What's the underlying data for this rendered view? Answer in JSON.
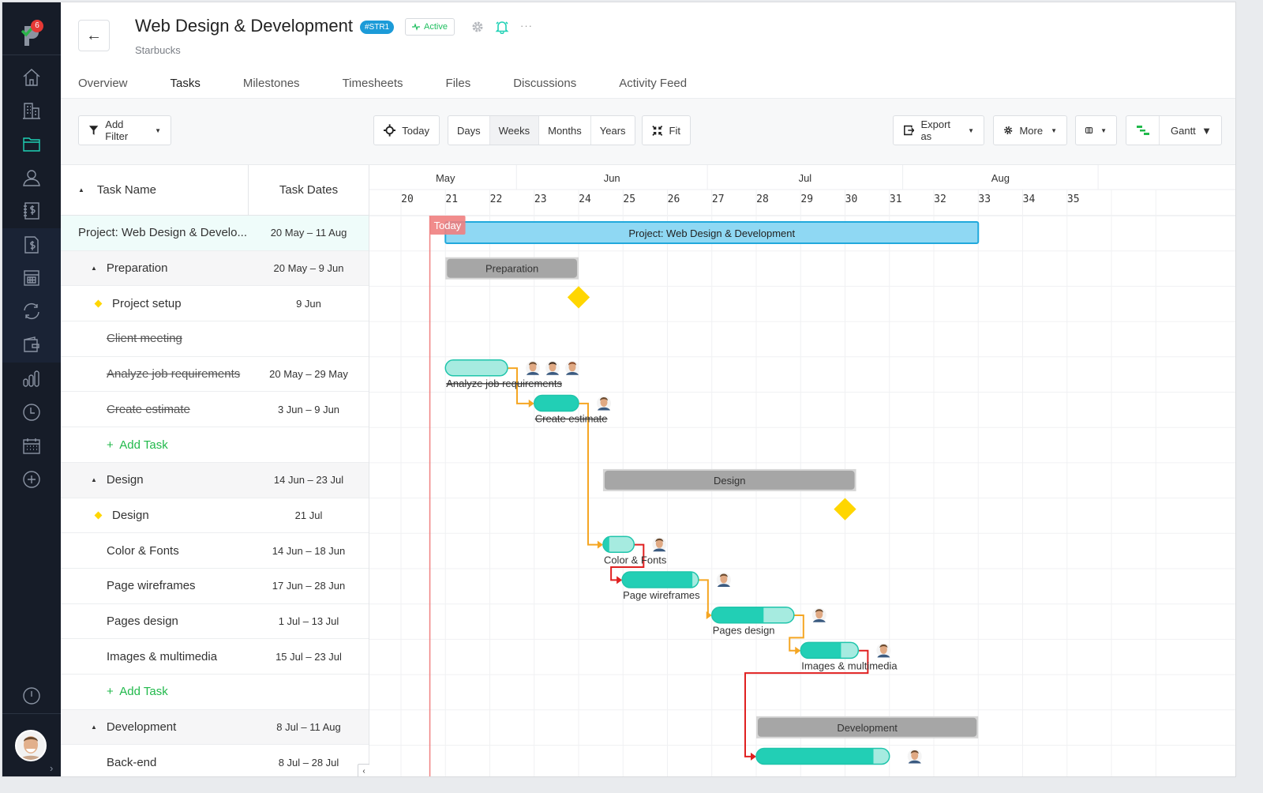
{
  "sidebar": {
    "logo_badge": "6",
    "items": [
      {
        "icon": "home-icon",
        "active": false
      },
      {
        "icon": "buildings-icon",
        "active": false
      },
      {
        "icon": "folder-icon",
        "active": true
      },
      {
        "icon": "user-icon",
        "active": false
      },
      {
        "icon": "ledger-dollar-icon",
        "active": false
      },
      {
        "icon": "invoice-dollar-icon",
        "active": false
      },
      {
        "icon": "calculator-icon",
        "active": false
      },
      {
        "icon": "sync-icon",
        "active": false
      },
      {
        "icon": "wallet-icon",
        "active": false
      },
      {
        "icon": "bar-chart-icon",
        "active": false
      },
      {
        "icon": "clock-icon",
        "active": false
      },
      {
        "icon": "calendar-icon",
        "active": false
      },
      {
        "icon": "plus-circle-icon",
        "active": false
      }
    ],
    "bottom_icon": "info-icon"
  },
  "header": {
    "title": "Web Design & Development",
    "tag": "#STR1",
    "status": "Active",
    "client": "Starbucks",
    "accent_color": "#1fd1b5"
  },
  "tabs": [
    {
      "label": "Overview",
      "active": false
    },
    {
      "label": "Tasks",
      "active": true
    },
    {
      "label": "Milestones",
      "active": false
    },
    {
      "label": "Timesheets",
      "active": false
    },
    {
      "label": "Files",
      "active": false
    },
    {
      "label": "Discussions",
      "active": false
    },
    {
      "label": "Activity Feed",
      "active": false
    }
  ],
  "toolbar": {
    "add_filter": "Add Filter",
    "today": "Today",
    "scales": [
      {
        "label": "Days",
        "active": false
      },
      {
        "label": "Weeks",
        "active": true
      },
      {
        "label": "Months",
        "active": false
      },
      {
        "label": "Years",
        "active": false
      }
    ],
    "fit": "Fit",
    "export": "Export as",
    "more": "More",
    "view": "Gantt"
  },
  "grid": {
    "col_name": "Task Name",
    "col_dates": "Task Dates",
    "rows": [
      {
        "name": "Project: Web Design & Develo...",
        "dates": "20 May – 11 Aug",
        "type": "project"
      },
      {
        "name": "Preparation",
        "dates": "20 May – 9 Jun",
        "type": "group"
      },
      {
        "name": "Project setup",
        "dates": "9 Jun",
        "type": "milestone"
      },
      {
        "name": "Client meeting",
        "dates": "",
        "type": "done"
      },
      {
        "name": "Analyze job requirements",
        "dates": "20 May – 29 May",
        "type": "done"
      },
      {
        "name": "Create estimate",
        "dates": "3 Jun – 9 Jun",
        "type": "done"
      },
      {
        "name": "Add Task",
        "dates": "",
        "type": "add"
      },
      {
        "name": "Design",
        "dates": "14 Jun – 23 Jul",
        "type": "group"
      },
      {
        "name": "Design",
        "dates": "21 Jul",
        "type": "milestone"
      },
      {
        "name": "Color & Fonts",
        "dates": "14 Jun – 18 Jun",
        "type": "task"
      },
      {
        "name": "Page wireframes",
        "dates": "17 Jun – 28 Jun",
        "type": "task"
      },
      {
        "name": "Pages design",
        "dates": "1 Jul – 13 Jul",
        "type": "task"
      },
      {
        "name": "Images & multimedia",
        "dates": "15 Jul – 23 Jul",
        "type": "task"
      },
      {
        "name": "Add Task",
        "dates": "",
        "type": "add"
      },
      {
        "name": "Development",
        "dates": "8 Jul – 11 Aug",
        "type": "group"
      },
      {
        "name": "Back-end",
        "dates": "8 Jul – 28 Jul",
        "type": "task"
      }
    ]
  },
  "gantt": {
    "months": [
      {
        "label": "May",
        "start_week": 19.4,
        "end_week": 22.6
      },
      {
        "label": "Jun",
        "start_week": 22.6,
        "end_week": 26.9
      },
      {
        "label": "Jul",
        "start_week": 26.9,
        "end_week": 31.3
      },
      {
        "label": "Aug",
        "start_week": 31.3,
        "end_week": 35.7
      }
    ],
    "weeks": [
      20,
      21,
      22,
      23,
      24,
      25,
      26,
      27,
      28,
      29,
      30,
      31,
      32,
      33,
      34,
      35
    ],
    "today_label": "Today",
    "today_week": 20.65,
    "bars": [
      {
        "row": 0,
        "kind": "project",
        "label": "Project: Web Design & Development",
        "start": 21.0,
        "end": 33.0,
        "color": "#8fd8f3"
      },
      {
        "row": 1,
        "kind": "group",
        "label": "Preparation",
        "start": 21.0,
        "end": 24.0,
        "color": "#a6a6a6"
      },
      {
        "row": 2,
        "kind": "milestone",
        "at": 24.0,
        "color": "#ffd600"
      },
      {
        "row": 4,
        "kind": "task",
        "label": "Analyze job requirements",
        "start": 21.0,
        "end": 22.4,
        "progress": 0,
        "done": true,
        "assignees": 3
      },
      {
        "row": 5,
        "kind": "task",
        "label": "Create estimate",
        "start": 23.0,
        "end": 24.0,
        "progress": 1,
        "done": true,
        "assignees": 1
      },
      {
        "row": 7,
        "kind": "group",
        "label": "Design",
        "start": 24.55,
        "end": 30.25,
        "color": "#a6a6a6"
      },
      {
        "row": 8,
        "kind": "milestone",
        "at": 30.0,
        "color": "#ffd600"
      },
      {
        "row": 9,
        "kind": "task",
        "label": "Color & Fonts",
        "start": 24.55,
        "end": 25.25,
        "progress": 0.2,
        "done": false,
        "assignees": 1
      },
      {
        "row": 10,
        "kind": "task",
        "label": "Page wireframes",
        "start": 24.98,
        "end": 26.7,
        "progress": 0.92,
        "done": false,
        "assignees": 1
      },
      {
        "row": 11,
        "kind": "task",
        "label": "Pages design",
        "start": 27.0,
        "end": 28.85,
        "progress": 0.63,
        "done": false,
        "assignees": 1
      },
      {
        "row": 12,
        "kind": "task",
        "label": "Images & multimedia",
        "start": 29.0,
        "end": 30.3,
        "progress": 0.7,
        "done": false,
        "assignees": 1
      },
      {
        "row": 14,
        "kind": "group",
        "label": "Development",
        "start": 28.0,
        "end": 33.0,
        "color": "#a6a6a6"
      },
      {
        "row": 15,
        "kind": "task",
        "label": "",
        "start": 28.0,
        "end": 31.0,
        "progress": 0.88,
        "done": false,
        "assignees": 1
      }
    ],
    "links": [
      {
        "from": 4,
        "to": 5,
        "color": "#f5a623"
      },
      {
        "from": 5,
        "to": 9,
        "color": "#f5a623"
      },
      {
        "from": 9,
        "to": 10,
        "color": "#e02020"
      },
      {
        "from": 10,
        "to": 11,
        "color": "#f5a623"
      },
      {
        "from": 11,
        "to": 12,
        "color": "#f5a623"
      },
      {
        "from": 12,
        "to": 15,
        "color": "#e02020"
      }
    ],
    "task_color": "#22cfb5",
    "task_light_color": "#a6ebe0",
    "today_color": "#f08080"
  }
}
